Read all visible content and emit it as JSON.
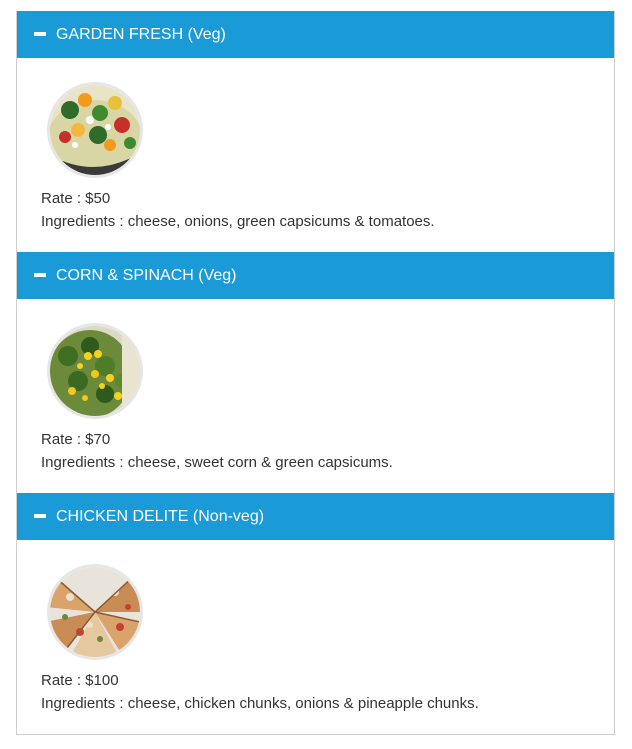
{
  "colors": {
    "header_bg": "#1a9ad7",
    "header_text": "#ffffff",
    "body_text": "#333333",
    "border": "#cfcfcf"
  },
  "sections": [
    {
      "title": "GARDEN FRESH (Veg)",
      "icon": "minus-icon",
      "image": "pizza-garden-fresh-image",
      "rate_label": "Rate : $50",
      "ingredients_label": "Ingredients : cheese, onions, green capsicums & tomatoes."
    },
    {
      "title": "CORN & SPINACH (Veg)",
      "icon": "minus-icon",
      "image": "pizza-corn-spinach-image",
      "rate_label": "Rate : $70",
      "ingredients_label": "Ingredients : cheese, sweet corn & green capsicums."
    },
    {
      "title": "CHICKEN DELITE (Non-veg)",
      "icon": "minus-icon",
      "image": "pizza-chicken-delite-image",
      "rate_label": "Rate : $100",
      "ingredients_label": "Ingredients : cheese, chicken chunks, onions & pineapple chunks."
    }
  ]
}
